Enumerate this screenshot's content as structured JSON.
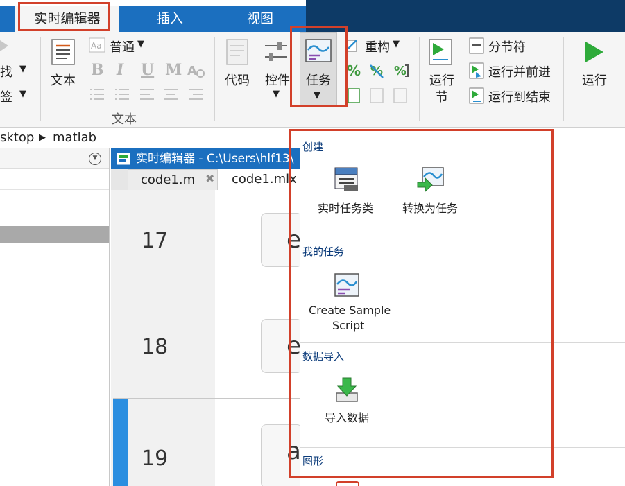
{
  "tabs": {
    "live_editor": "实时编辑器",
    "insert": "插入",
    "view": "视图"
  },
  "ribbon": {
    "find_partial": "找",
    "bookmark_partial": "签",
    "text_button": "文本",
    "text_group": "文本",
    "style_select": "普通",
    "bold": "B",
    "italic": "I",
    "underline": "U",
    "monospace": "M",
    "code_button": "代码",
    "control_button": "控件",
    "task_button": "任务",
    "refactor_button": "重构",
    "run_section_line1": "运行",
    "run_section_line2": "节",
    "section_break": "分节符",
    "run_and_advance": "运行并前进",
    "run_to_end": "运行到结束",
    "run_button": "运行"
  },
  "path": {
    "segment1": "sktop",
    "segment2": "matlab"
  },
  "editor": {
    "title": "实时编辑器 - C:\\Users\\hlf13\\",
    "tab1": "code1.m",
    "tab2": "code1.mlx",
    "line17": "17",
    "line18": "18",
    "line19": "19",
    "code17": "e",
    "code18": "e",
    "code19": "a"
  },
  "dropdown": {
    "section_create": "创建",
    "live_task_class": "实时任务类",
    "convert_to_task": "转换为任务",
    "section_my_tasks": "我的任务",
    "create_sample_line1": "Create Sample",
    "create_sample_line2": "Script",
    "section_import": "数据导入",
    "import_data": "导入数据",
    "section_graphics": "图形"
  }
}
